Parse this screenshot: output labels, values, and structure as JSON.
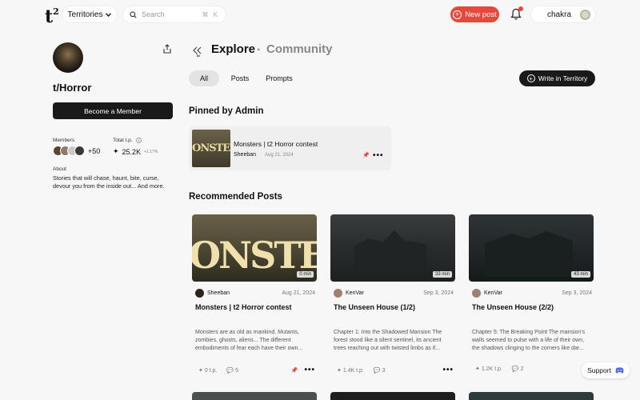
{
  "header": {
    "logo": "t",
    "logo_sup": "2",
    "territories_label": "Territories",
    "search_placeholder": "Search",
    "search_shortcut": "⌘ K",
    "new_post_label": "New post",
    "username": "chakra"
  },
  "sidebar": {
    "territory_name": "t/Horror",
    "become_member_label": "Become a Member",
    "members_label": "Members",
    "members_extra": "+50",
    "total_tp_label": "Total t.p.",
    "total_tp_value": "25.2K",
    "total_tp_change": "+1.17%",
    "about_label": "About",
    "about_text": "Stories that will chase, haunt, bite, curse, devour you from the inside out... And more."
  },
  "main": {
    "breadcrumb": {
      "explore": "Explore",
      "separator": "•",
      "community": "Community"
    },
    "tabs": [
      {
        "label": "All",
        "active": true
      },
      {
        "label": "Posts",
        "active": false
      },
      {
        "label": "Prompts",
        "active": false
      }
    ],
    "write_label": "Write in Territory",
    "pinned_title": "Pinned by Admin",
    "pinned_post": {
      "thumb_text": "ONSTE",
      "title": "Monsters | t2 Horror contest",
      "author": "Sheeban",
      "date": "Aug 21, 2024"
    },
    "recommended_title": "Recommended Posts",
    "posts": [
      {
        "image_text": "ONSTE",
        "duration": "0 min",
        "author": "Sheeban",
        "date": "Aug 21, 2024",
        "title": "Monsters | t2 Horror contest",
        "excerpt": "Monsters are as old as mankind. Mutants, zombies, ghosts, aliens... The different embodiments of fear each have their own...",
        "tp": "0 t.p.",
        "comments": "5",
        "pinned": true
      },
      {
        "image_text": "",
        "duration": "33 min",
        "author": "KenVar",
        "date": "Sep 3, 2024",
        "title": "The Unseen House (1/2)",
        "excerpt": "Chapter 1: Into the Shadowed Mansion The forest stood like a silent sentinel, its ancient trees reaching out with twisted limbs as if...",
        "tp": "1.4K t.p.",
        "comments": "3",
        "pinned": false
      },
      {
        "image_text": "",
        "duration": "43 min",
        "author": "KenVar",
        "date": "Sep 3, 2024",
        "title": "The Unseen House (2/2)",
        "excerpt": "Chapter 5: The Breaking Point The mansion's walls seemed to pulse with a life of their own, the shadows clinging to the corners like dar...",
        "tp": "1.2K t.p.",
        "comments": "2",
        "pinned": false
      }
    ]
  },
  "support_label": "Support",
  "colors": {
    "accent": "#e9463c",
    "dark": "#1a1a1a"
  }
}
